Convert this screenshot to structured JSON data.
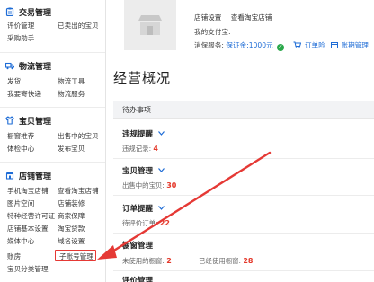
{
  "sidebar": {
    "sections": [
      {
        "title": "交易管理",
        "icon": "clipboard-icon",
        "links": [
          [
            "评价管理",
            "已卖出的宝贝"
          ],
          [
            "采购助手",
            ""
          ]
        ]
      },
      {
        "title": "物流管理",
        "icon": "truck-icon",
        "links": [
          [
            "发货",
            "物流工具"
          ],
          [
            "我要寄快递",
            "物流服务"
          ]
        ]
      },
      {
        "title": "宝贝管理",
        "icon": "shirt-icon",
        "links": [
          [
            "橱窗推荐",
            "出售中的宝贝"
          ],
          [
            "体检中心",
            "发布宝贝"
          ]
        ]
      },
      {
        "title": "店铺管理",
        "icon": "store-icon",
        "links": [
          [
            "手机淘宝店铺",
            "查看淘宝店铺"
          ],
          [
            "图片空间",
            "店铺装修"
          ],
          [
            "特种经营许可证",
            "商家保障"
          ],
          [
            "店铺基本设置",
            "淘宝贷款"
          ],
          [
            "媒体中心",
            "域名设置"
          ],
          [
            "账房",
            "子账号管理"
          ],
          [
            "宝贝分类管理",
            ""
          ]
        ]
      }
    ],
    "accent_color": "#1e6cd6",
    "highlight_color": "#e53935"
  },
  "shop": {
    "settings_link": "店铺设置",
    "view_shop_link": "查看淘宝店铺",
    "alipay_label": "我的支付宝:",
    "service_label": "消保服务:",
    "deposit_text": "保证金:1000元",
    "subscribe_text": "订单险",
    "account_text": "账期管理"
  },
  "overview": {
    "title": "经营概况",
    "todo_label": "待办事项",
    "groups": [
      {
        "title": "违规提醒",
        "line_label": "违规记录:",
        "value": "4",
        "value2_label": "",
        "value2": ""
      },
      {
        "title": "宝贝管理",
        "line_label": "出售中的宝贝:",
        "value": "30",
        "value2_label": "",
        "value2": ""
      },
      {
        "title": "订单提醒",
        "line_label": "待评价订单:",
        "value": "22",
        "value2_label": "",
        "value2": ""
      },
      {
        "title": "橱窗管理",
        "line_label": "未使用的橱窗:",
        "value": "2",
        "value2_label": "已经使用橱窗:",
        "value2": "28"
      },
      {
        "title": "评价管理",
        "line_label": "",
        "value": "",
        "value2_label": "",
        "value2": ""
      }
    ],
    "number_color": "#e4392b"
  }
}
